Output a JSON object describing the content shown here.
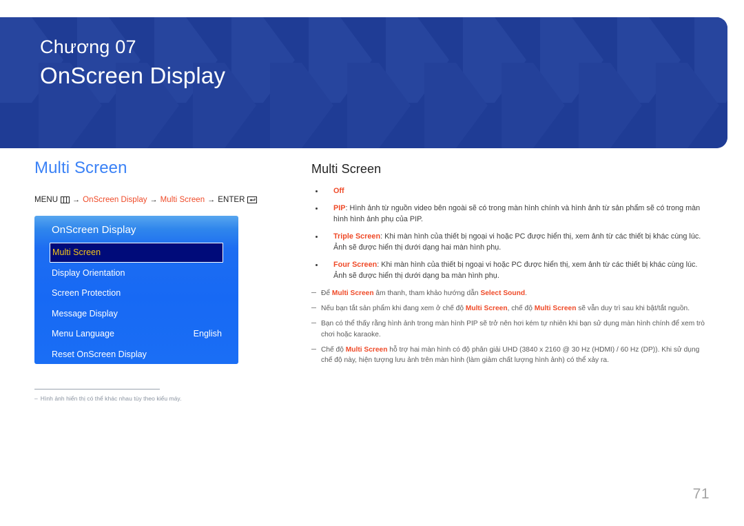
{
  "banner": {
    "chapter_label": "Chương 07",
    "chapter_title": "OnScreen Display",
    "background_color": "#1f3c95"
  },
  "left": {
    "heading": "Multi Screen",
    "heading_color": "#3b82f6",
    "breadcrumb": {
      "menu_label": "MENU",
      "menu_icon": "menu-bars-icon",
      "arrow1": "→",
      "path1": "OnScreen Display",
      "arrow2": "→",
      "path2": "Multi Screen",
      "arrow3": "→",
      "enter_label": "ENTER",
      "enter_icon": "enter-key-icon",
      "accent_color": "#ef4a28"
    },
    "osd": {
      "title": "OnScreen Display",
      "selected_index": 0,
      "selected_bg": "#000b7a",
      "selected_text_color": "#f5c518",
      "items": [
        {
          "label": "Multi Screen",
          "value": "",
          "selected": true
        },
        {
          "label": "Display Orientation",
          "value": "",
          "selected": false
        },
        {
          "label": "Screen Protection",
          "value": "",
          "selected": false
        },
        {
          "label": "Message Display",
          "value": "",
          "selected": false
        },
        {
          "label": "Menu Language",
          "value": "English",
          "selected": false
        },
        {
          "label": "Reset OnScreen Display",
          "value": "",
          "selected": false
        }
      ]
    },
    "footnote": {
      "dash": "‒",
      "text": "Hình ảnh hiển thị có thể khác nhau tùy theo kiểu máy."
    }
  },
  "right": {
    "heading": "Multi Screen",
    "bullets": [
      {
        "term": "Off",
        "separator": "",
        "text": ""
      },
      {
        "term": "PIP",
        "separator": ": ",
        "text": "Hình ảnh từ nguồn video bên ngoài sẽ có trong màn hình chính và hình ảnh từ sản phẩm sẽ có trong màn hình hình ảnh phụ của PIP."
      },
      {
        "term": "Triple Screen",
        "separator": ": ",
        "text": "Khi màn hình của thiết bị ngoại vi hoặc PC được hiển thị, xem ảnh từ các thiết bị khác cùng lúc. Ảnh sẽ được hiển thị dưới dạng hai màn hình phụ."
      },
      {
        "term": "Four Screen",
        "separator": ": ",
        "text": "Khi màn hình của thiết bị ngoại vi hoặc PC được hiển thị, xem ảnh từ các thiết bị khác cùng lúc. Ảnh sẽ được hiển thị dưới dạng ba màn hình phụ."
      }
    ],
    "notes": [
      {
        "parts": [
          {
            "text": "Để ",
            "accent": false
          },
          {
            "text": "Multi Screen",
            "accent": true
          },
          {
            "text": " âm thanh, tham khảo hướng dẫn ",
            "accent": false
          },
          {
            "text": "Select Sound",
            "accent": true
          },
          {
            "text": ".",
            "accent": false
          }
        ]
      },
      {
        "parts": [
          {
            "text": "Nếu bạn tắt sản phẩm khi đang xem ở chế độ ",
            "accent": false
          },
          {
            "text": "Multi Screen",
            "accent": true
          },
          {
            "text": ", chế độ ",
            "accent": false
          },
          {
            "text": "Multi Screen",
            "accent": true
          },
          {
            "text": " sẽ vẫn duy trì sau khi bật/tắt nguồn.",
            "accent": false
          }
        ]
      },
      {
        "parts": [
          {
            "text": "Bạn có thể thấy rằng hình ảnh trong màn hình PIP sẽ trở nên hơi kém tự nhiên khi bạn sử dụng màn hình chính để xem trò chơi hoặc karaoke.",
            "accent": false
          }
        ]
      },
      {
        "parts": [
          {
            "text": "Chế độ ",
            "accent": false
          },
          {
            "text": "Multi Screen",
            "accent": true
          },
          {
            "text": " hỗ trợ hai màn hình có độ phân giải UHD (3840 x 2160 @ 30 Hz (HDMI) / 60 Hz (DP)). Khi sử dụng chế độ này, hiện tượng lưu ảnh trên màn hình (làm giảm chất lượng hình ảnh) có thể xảy ra.",
            "accent": false
          }
        ]
      }
    ]
  },
  "page_number": "71"
}
